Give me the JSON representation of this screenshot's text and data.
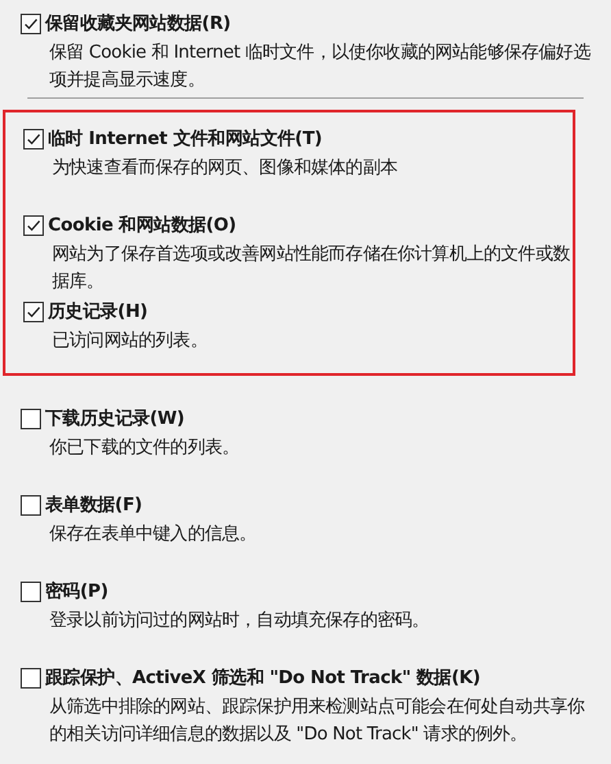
{
  "top_item": {
    "title": "保留收藏夹网站数据(R)",
    "description": "保留 Cookie 和 Internet 临时文件，以使你收藏的网站能够保存偏好选项并提高显示速度。",
    "checked": true
  },
  "highlighted_items": [
    {
      "title": "临时 Internet 文件和网站文件(T)",
      "description": "为快速查看而保存的网页、图像和媒体的副本",
      "checked": true
    },
    {
      "title": "Cookie 和网站数据(O)",
      "description": "网站为了保存首选项或改善网站性能而存储在你计算机上的文件或数据库。",
      "checked": true
    },
    {
      "title": "历史记录(H)",
      "description": "已访问网站的列表。",
      "checked": true
    }
  ],
  "other_items": [
    {
      "title": "下载历史记录(W)",
      "description": "你已下载的文件的列表。",
      "checked": false
    },
    {
      "title": "表单数据(F)",
      "description": "保存在表单中键入的信息。",
      "checked": false
    },
    {
      "title": "密码(P)",
      "description": "登录以前访问过的网站时，自动填充保存的密码。",
      "checked": false
    },
    {
      "title": "跟踪保护、ActiveX 筛选和 \"Do Not Track\" 数据(K)",
      "description": "从筛选中排除的网站、跟踪保护用来检测站点可能会在何处自动共享你的相关访问详细信息的数据以及 \"Do Not Track\" 请求的例外。",
      "checked": false
    }
  ]
}
